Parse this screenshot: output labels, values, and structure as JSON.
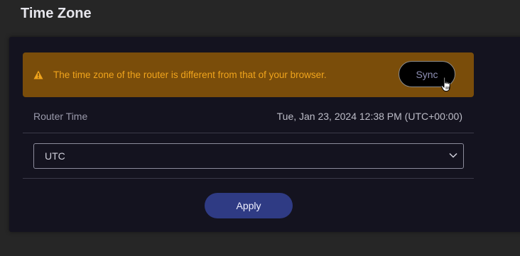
{
  "page": {
    "title": "Time Zone"
  },
  "warning": {
    "message": "The time zone of the router is different from that of your browser.",
    "sync_label": "Sync",
    "icon": "warning-triangle-icon"
  },
  "router_time": {
    "label": "Router Time",
    "value": "Tue, Jan 23, 2024 12:38 PM (UTC+00:00)"
  },
  "timezone_select": {
    "selected": "UTC",
    "icon": "chevron-down-icon"
  },
  "actions": {
    "apply_label": "Apply"
  },
  "colors": {
    "background": "#262626",
    "panel": "#14131f",
    "warning_bg": "#7a4d0a",
    "warning_text": "#f0a41c",
    "apply_bg": "#2f3b84"
  }
}
